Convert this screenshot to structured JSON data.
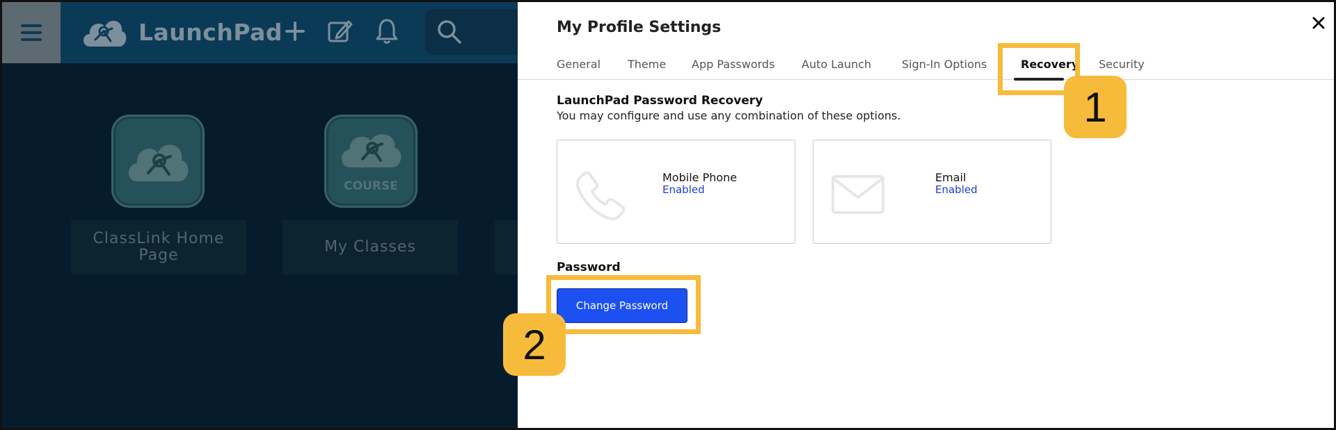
{
  "background_app": {
    "name": "LaunchPad",
    "tiles": [
      {
        "label": "ClassLink Home Page",
        "icon": "classlink-cloud-icon"
      },
      {
        "label": "My Classes",
        "icon": "course-cloud-icon",
        "icon_text": "COURSE"
      }
    ]
  },
  "settings": {
    "title": "My Profile Settings",
    "tabs": [
      {
        "label": "General"
      },
      {
        "label": "Theme"
      },
      {
        "label": "App Passwords"
      },
      {
        "label": "Auto Launch"
      },
      {
        "label": "Sign-In Options"
      },
      {
        "label": "Recovery",
        "active": true
      },
      {
        "label": "Security"
      }
    ],
    "recovery": {
      "heading": "LaunchPad Password Recovery",
      "description": "You may configure and use any combination of these options.",
      "options": [
        {
          "label": "Mobile Phone",
          "status": "Enabled",
          "icon": "phone-icon"
        },
        {
          "label": "Email",
          "status": "Enabled",
          "icon": "envelope-icon"
        }
      ]
    },
    "password": {
      "heading": "Password",
      "button_label": "Change Password"
    }
  },
  "callouts": [
    {
      "number": "1",
      "target": "Recovery"
    },
    {
      "number": "2",
      "target": "Change Password"
    }
  ],
  "colors": {
    "primary_button": "#1c50f0",
    "status_link": "#1a3ed8",
    "callout": "#f7bb3c",
    "overlay_bg": "#061c2c"
  }
}
